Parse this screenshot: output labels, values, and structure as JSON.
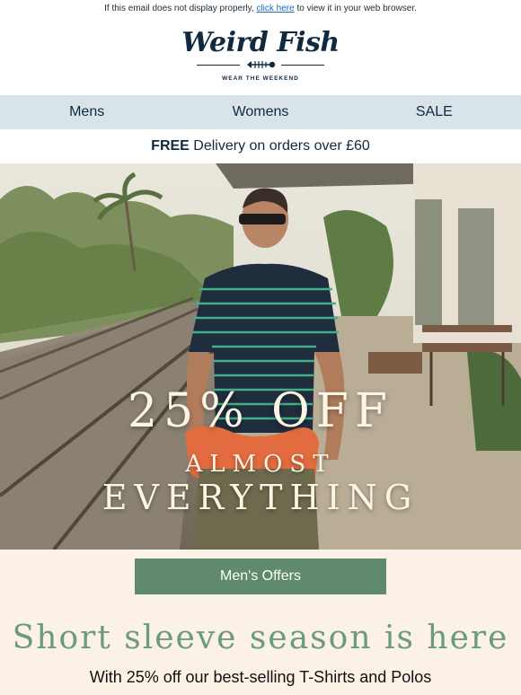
{
  "preheader": {
    "before_link": "If this email does not display properly, ",
    "link": "click here",
    "after_link": " to view it in your web browser."
  },
  "brand": {
    "name": "Weird Fish",
    "tagline": "WEAR THE WEEKEND",
    "logo_icon": "fish-skeleton-icon"
  },
  "nav": {
    "items": [
      {
        "label": "Mens"
      },
      {
        "label": "Womens"
      },
      {
        "label": "SALE"
      }
    ]
  },
  "promo_strip": {
    "bold": "FREE",
    "text": " Delivery on orders over £60"
  },
  "hero": {
    "headline": "25% OFF",
    "sub_line_1": "ALMOST",
    "sub_line_2": "EVERYTHING",
    "image": "man-on-train-platform-photo"
  },
  "offers": {
    "button_label": "Men's Offers",
    "title": "Short sleeve season is here",
    "subtitle": "With 25% off our best-selling T-Shirts and Polos"
  },
  "colors": {
    "navy": "#0f2a40",
    "nav_bg": "#d9e3ea",
    "button_green": "#5f8a6e",
    "title_green": "#6a9a7f",
    "cream": "#fbf1e7"
  }
}
